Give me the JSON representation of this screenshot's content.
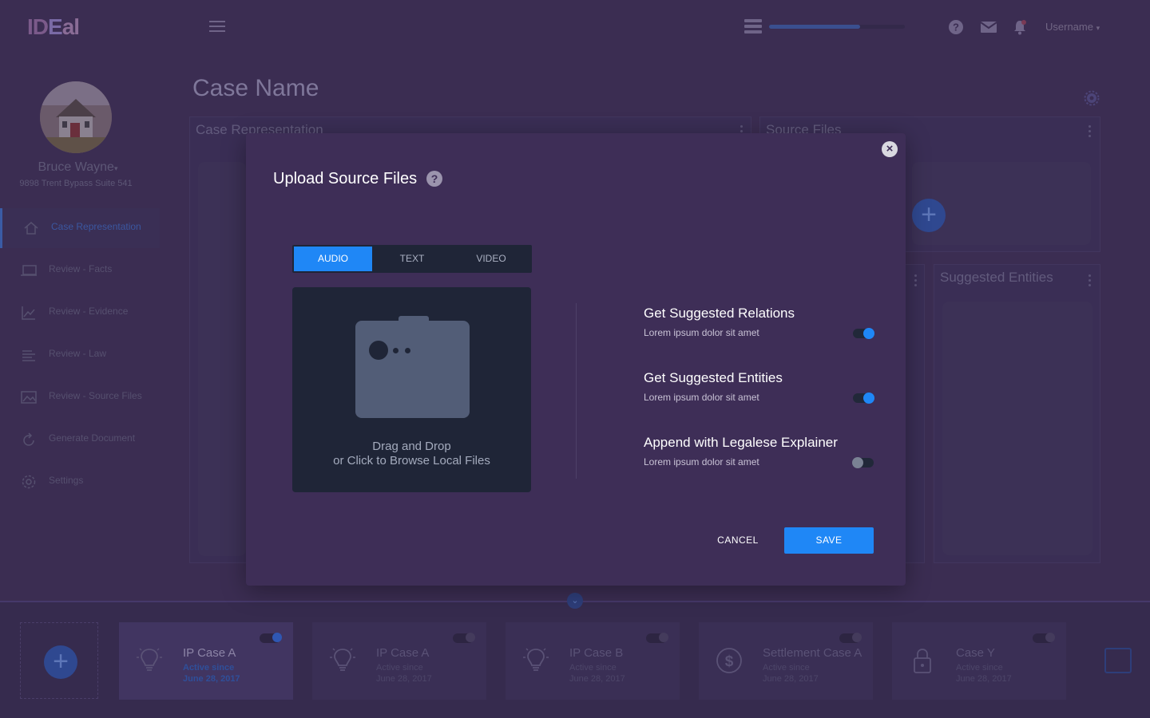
{
  "app": {
    "logo": {
      "part1": "ID",
      "part2": "E",
      "part3": "al"
    },
    "username": "Username",
    "upload_progress": 0.67
  },
  "profile": {
    "name": "Bruce Wayne",
    "address": "9898 Trent Bypass Suite 541"
  },
  "sidebar": {
    "items": [
      {
        "label": "Case Representation",
        "icon": "home-icon",
        "active": true
      },
      {
        "label": "Review - Facts",
        "icon": "laptop-icon",
        "active": false
      },
      {
        "label": "Review - Evidence",
        "icon": "chart-icon",
        "active": false
      },
      {
        "label": "Review - Law",
        "icon": "text-lines-icon",
        "active": false
      },
      {
        "label": "Review - Source Files",
        "icon": "image-icon",
        "active": false
      },
      {
        "label": "Generate Document",
        "icon": "refresh-icon",
        "active": false
      },
      {
        "label": "Settings",
        "icon": "gear-icon",
        "active": false
      }
    ]
  },
  "main": {
    "title": "Case Name",
    "panels": {
      "case_representation": "Case Representation",
      "source_files": "Source Files",
      "suggested_entities": "Suggested Entities"
    }
  },
  "cases": [
    {
      "name": "IP Case A",
      "since": "Active since",
      "date": "June 28, 2017",
      "icon": "lightbulb-icon",
      "selected": true
    },
    {
      "name": "IP Case A",
      "since": "Active since",
      "date": "June 28, 2017",
      "icon": "lightbulb-icon",
      "selected": false
    },
    {
      "name": "IP Case B",
      "since": "Active since",
      "date": "June 28, 2017",
      "icon": "lightbulb-icon",
      "selected": false
    },
    {
      "name": "Settlement Case A",
      "since": "Active since",
      "date": "June 28, 2017",
      "icon": "dollar-icon",
      "selected": false
    },
    {
      "name": "Case Y",
      "since": "Active since",
      "date": "June 28, 2017",
      "icon": "lock-icon",
      "selected": false
    }
  ],
  "modal": {
    "title": "Upload Source Files",
    "help": "?",
    "close": "×",
    "tabs": [
      {
        "label": "AUDIO",
        "active": true
      },
      {
        "label": "TEXT",
        "active": false
      },
      {
        "label": "VIDEO",
        "active": false
      }
    ],
    "dropzone": {
      "line1": "Drag and Drop",
      "line2": "or Click to Browse Local Files",
      "icon": "camera-icon"
    },
    "options": [
      {
        "title": "Get Suggested Relations",
        "desc": "Lorem ipsum dolor sit amet",
        "enabled": true
      },
      {
        "title": "Get Suggested Entities",
        "desc": "Lorem ipsum dolor sit amet",
        "enabled": true
      },
      {
        "title": "Append with Legalese Explainer",
        "desc": "Lorem ipsum dolor sit amet",
        "enabled": false
      }
    ],
    "cancel_label": "CANCEL",
    "save_label": "SAVE"
  },
  "colors": {
    "accent": "#1f87f6",
    "backdrop": "#3b2d52",
    "modal_bg": "#3e2e57",
    "dropzone_bg": "#1f2537"
  }
}
